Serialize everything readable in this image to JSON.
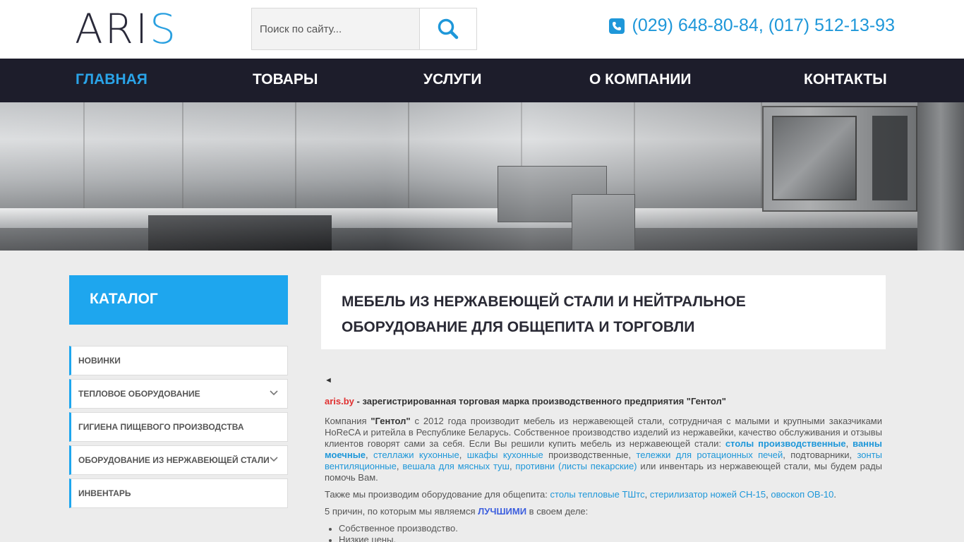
{
  "header": {
    "logo_main": "ARI",
    "logo_accent": "S",
    "search_placeholder": "Поиск по сайту...",
    "phone": "(029) 648-80-84, (017) 512-13-93"
  },
  "nav": {
    "items": [
      {
        "label": "ГЛАВНАЯ",
        "active": true
      },
      {
        "label": "ТОВАРЫ"
      },
      {
        "label": "УСЛУГИ"
      },
      {
        "label": "О КОМПАНИИ"
      },
      {
        "label": "КОНТАКТЫ"
      }
    ]
  },
  "catalog": {
    "title": "КАТАЛОГ",
    "items": [
      {
        "label": "НОВИНКИ"
      },
      {
        "label": "ТЕПЛОВОЕ ОБОРУДОВАНИЕ",
        "expandable": true
      },
      {
        "label": "ГИГИЕНА ПИЩЕВОГО ПРОИЗВОДСТВА"
      },
      {
        "label": "ОБОРУДОВАНИЕ ИЗ НЕРЖАВЕЮЩЕЙ СТАЛИ",
        "expandable": true
      },
      {
        "label": "ИНВЕНТАРЬ"
      }
    ]
  },
  "main": {
    "title_line1": "МЕБЕЛЬ ИЗ НЕРЖАВЕЮЩЕЙ СТАЛИ И НЕЙТРАЛЬНОЕ",
    "title_line2": "ОБОРУДОВАНИЕ ДЛЯ ОБЩЕПИТА И ТОРГОВЛИ",
    "arrow": "◄",
    "intro_brand": "aris.by",
    "intro_text": " - зарегистрированная торговая марка производственного предприятия \"Гентол\"",
    "p1": {
      "t1": "Компания ",
      "company": "\"Гентол\"",
      "t2": " с 2012 года производит мебель из нержавеющей стали, сотрудничая с малыми и крупными заказчиками HoReCA и ритейла в Республике Беларусь. Собственное производство изделий из нержавейки, качество обслуживания и отзывы клиентов говорят сами за себя. Если Вы решили купить мебель из нержавеющей  стали: ",
      "link1": "столы производственные",
      "sep1": ", ",
      "link2": "ванны моечные",
      "sep2": ", ",
      "link3": "стеллажи кухонные",
      "sep3": ", ",
      "link4": "шкафы кухонные",
      "t3": " производственные, ",
      "link5": "тележки для ротационных печей",
      "t4": ", подтоварники, ",
      "link6": "зонты вентиляционные",
      "sep6": ", ",
      "link7": "вешала для мясных туш",
      "sep7": ", ",
      "link8": "противни (листы пекарские)",
      "t5": " или инвентарь из нержавеющей стали, мы будем рады помочь Вам."
    },
    "p2": {
      "t1": "Также мы производим оборудование для общепита: ",
      "link1": "столы тепловые ТШтс",
      "sep1": ", ",
      "link2": "стерилизатор ножей СН-15",
      "sep2": ", ",
      "link3": "овоскоп ОВ-10",
      "t2": "."
    },
    "p3": {
      "t1": "5 причин, по которым мы являемся ",
      "best": "ЛУЧШИМИ",
      "t2": " в своем деле:"
    },
    "reasons": [
      "Собственное производство.",
      "Низкие цены."
    ]
  },
  "colors": {
    "accent": "#1ea6ee",
    "nav_bg": "#1d1d2b",
    "link": "#1e97d9",
    "brand_red": "#e03030"
  }
}
